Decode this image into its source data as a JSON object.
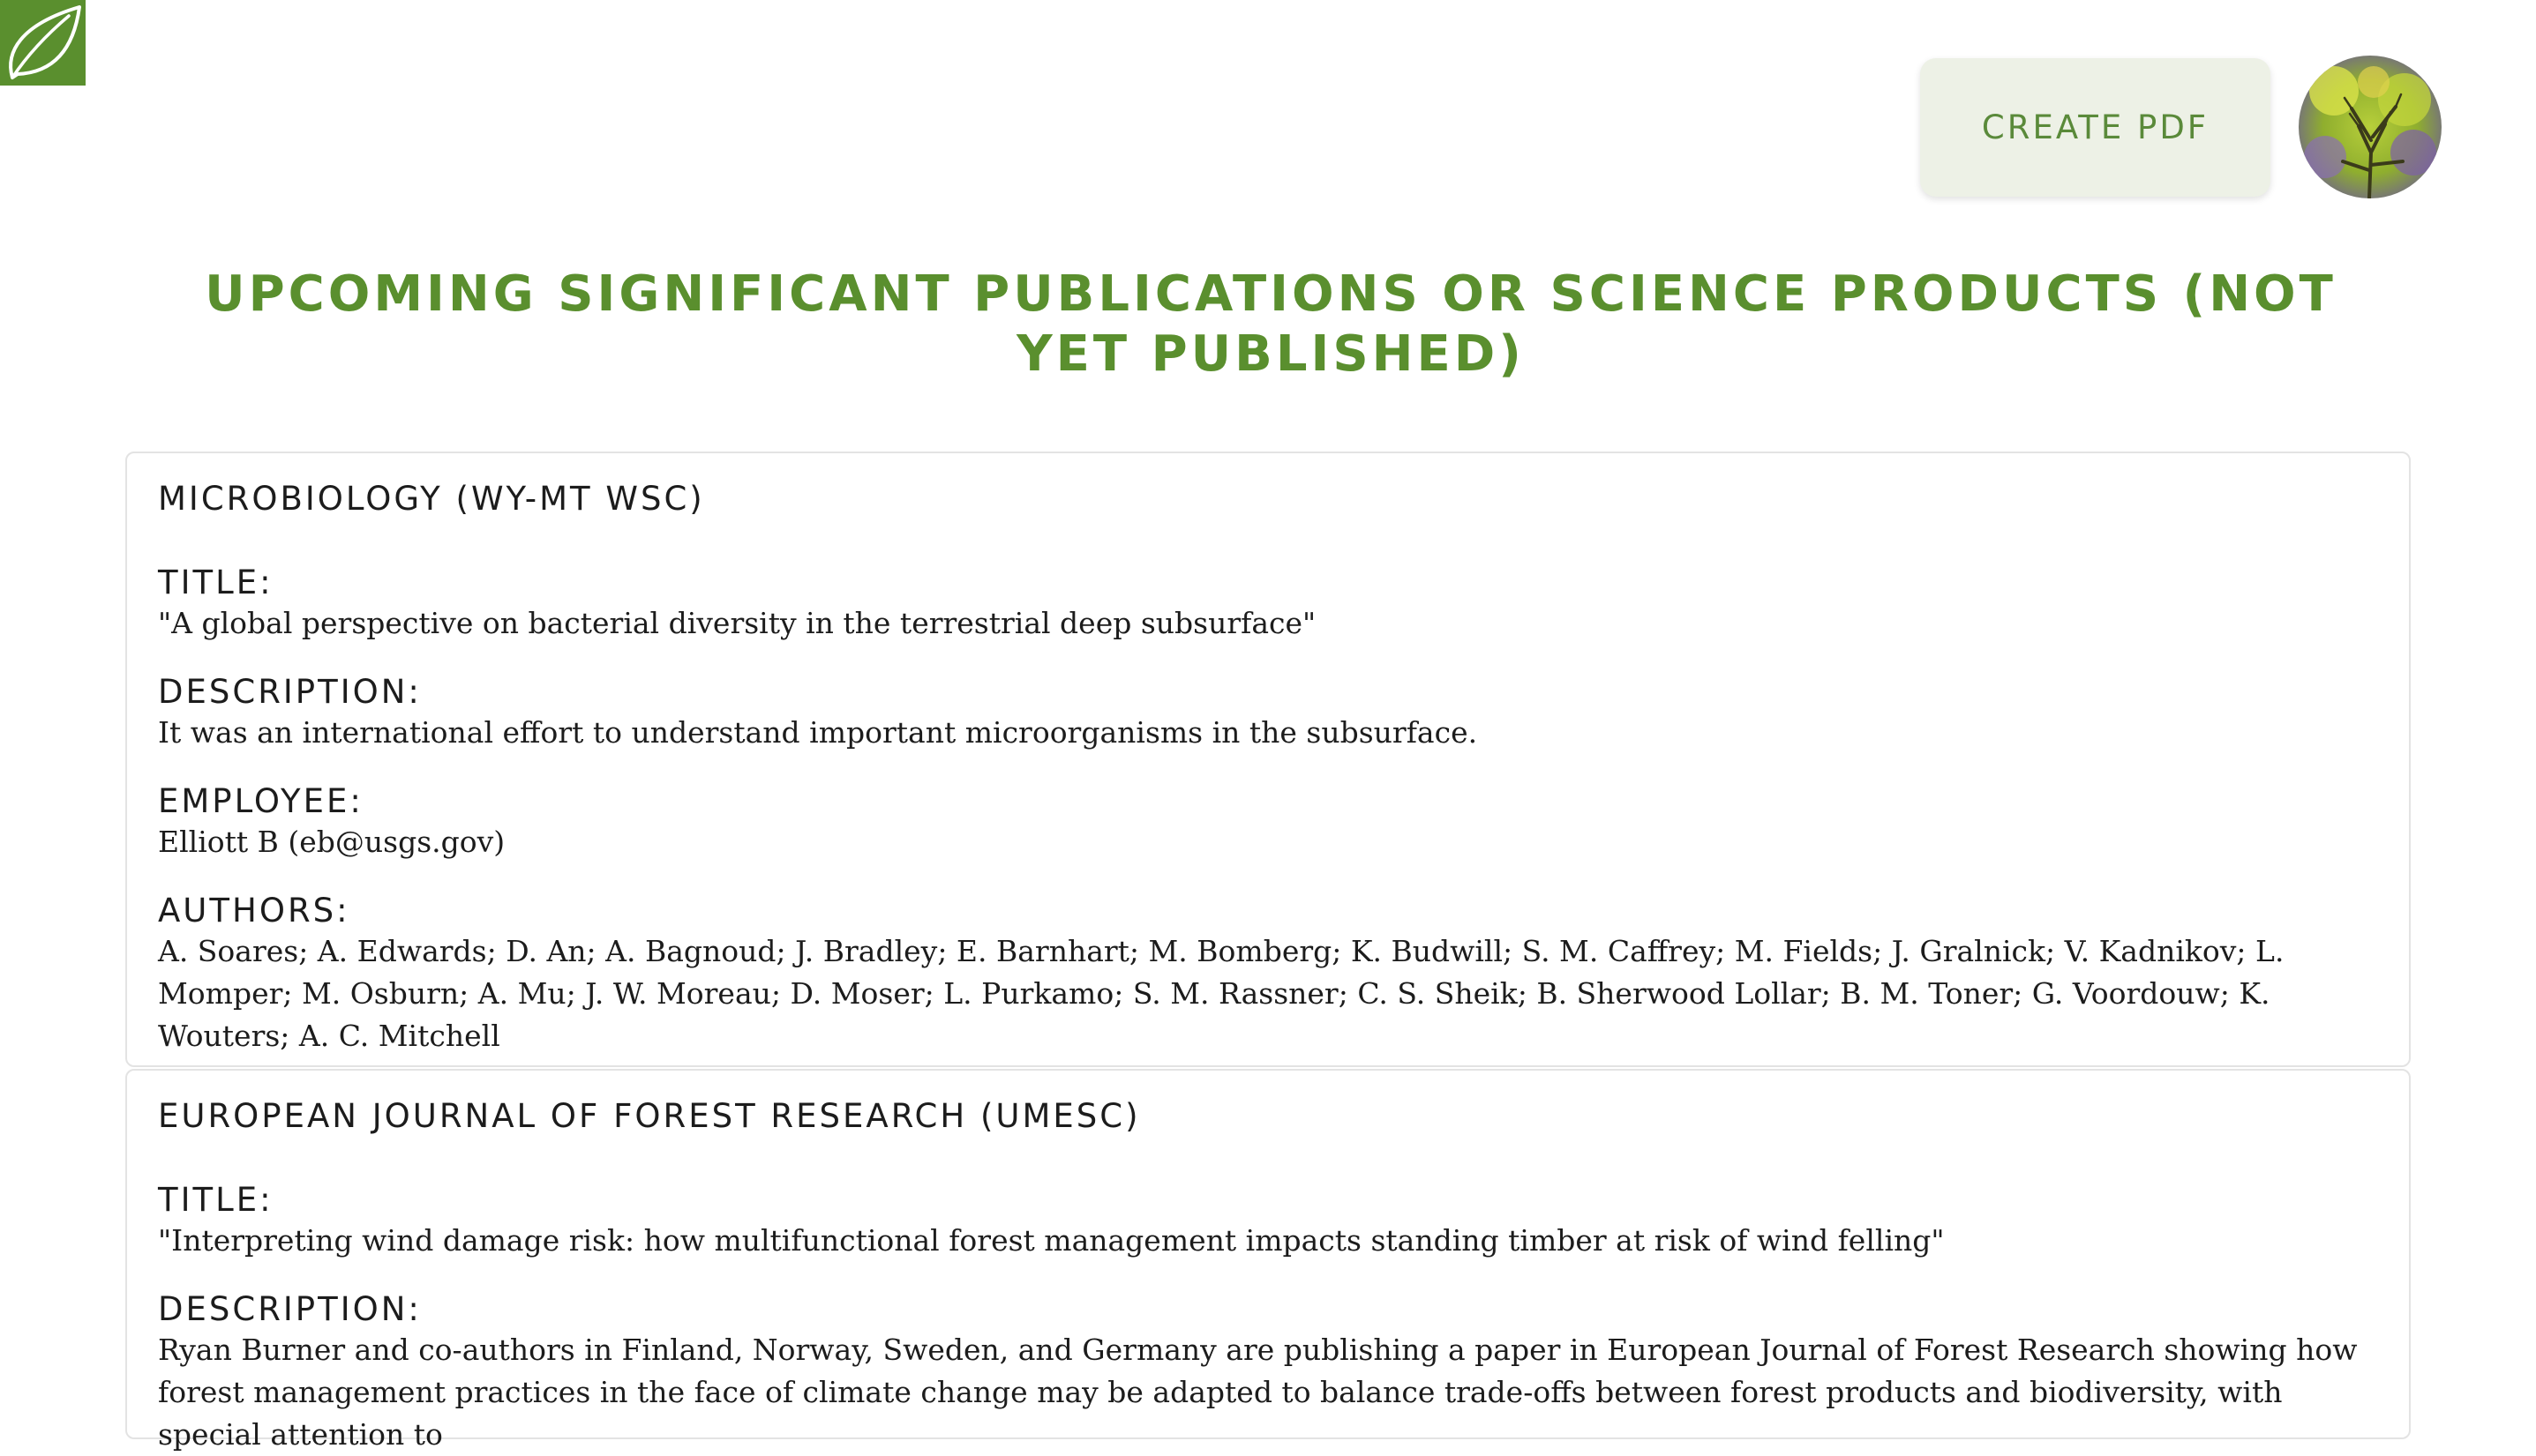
{
  "header": {
    "logo_icon": "leaf-icon",
    "create_pdf_label": "CREATE PDF",
    "avatar_icon": "tree-photo-avatar",
    "brand_color": "#5a8f2e"
  },
  "page": {
    "title": "UPCOMING SIGNIFICANT PUBLICATIONS OR SCIENCE PRODUCTS (NOT YET PUBLISHED)"
  },
  "publications": [
    {
      "heading": "MICROBIOLOGY (WY-MT WSC)",
      "title_label": "TITLE:",
      "title": "\"A global perspective on bacterial diversity in the terrestrial deep subsurface\"",
      "description_label": "DESCRIPTION:",
      "description": "It was an international effort to understand important microorganisms in the subsurface.",
      "employee_label": "EMPLOYEE:",
      "employee": "Elliott B (eb@usgs.gov)",
      "authors_label": "AUTHORS:",
      "authors": "A. Soares; A. Edwards; D. An; A. Bagnoud; J. Bradley; E. Barnhart; M. Bomberg; K. Budwill; S. M. Caffrey; M. Fields; J. Gralnick; V. Kadnikov; L. Momper; M. Osburn; A. Mu; J. W. Moreau; D. Moser; L. Purkamo; S. M. Rassner; C. S. Sheik; B. Sherwood Lollar; B. M. Toner; G. Voordouw; K. Wouters; A. C. Mitchell"
    },
    {
      "heading": "EUROPEAN JOURNAL OF FOREST RESEARCH (UMESC)",
      "title_label": "TITLE:",
      "title": "\"Interpreting wind damage risk: how multifunctional forest management impacts standing timber at risk of wind felling\"",
      "description_label": "DESCRIPTION:",
      "description": "Ryan Burner and co-authors in Finland, Norway, Sweden, and Germany are publishing a paper in European Journal of Forest Research showing how forest management practices in the face of climate change may be adapted to balance trade-offs between forest products and biodiversity, with special attention to"
    }
  ]
}
